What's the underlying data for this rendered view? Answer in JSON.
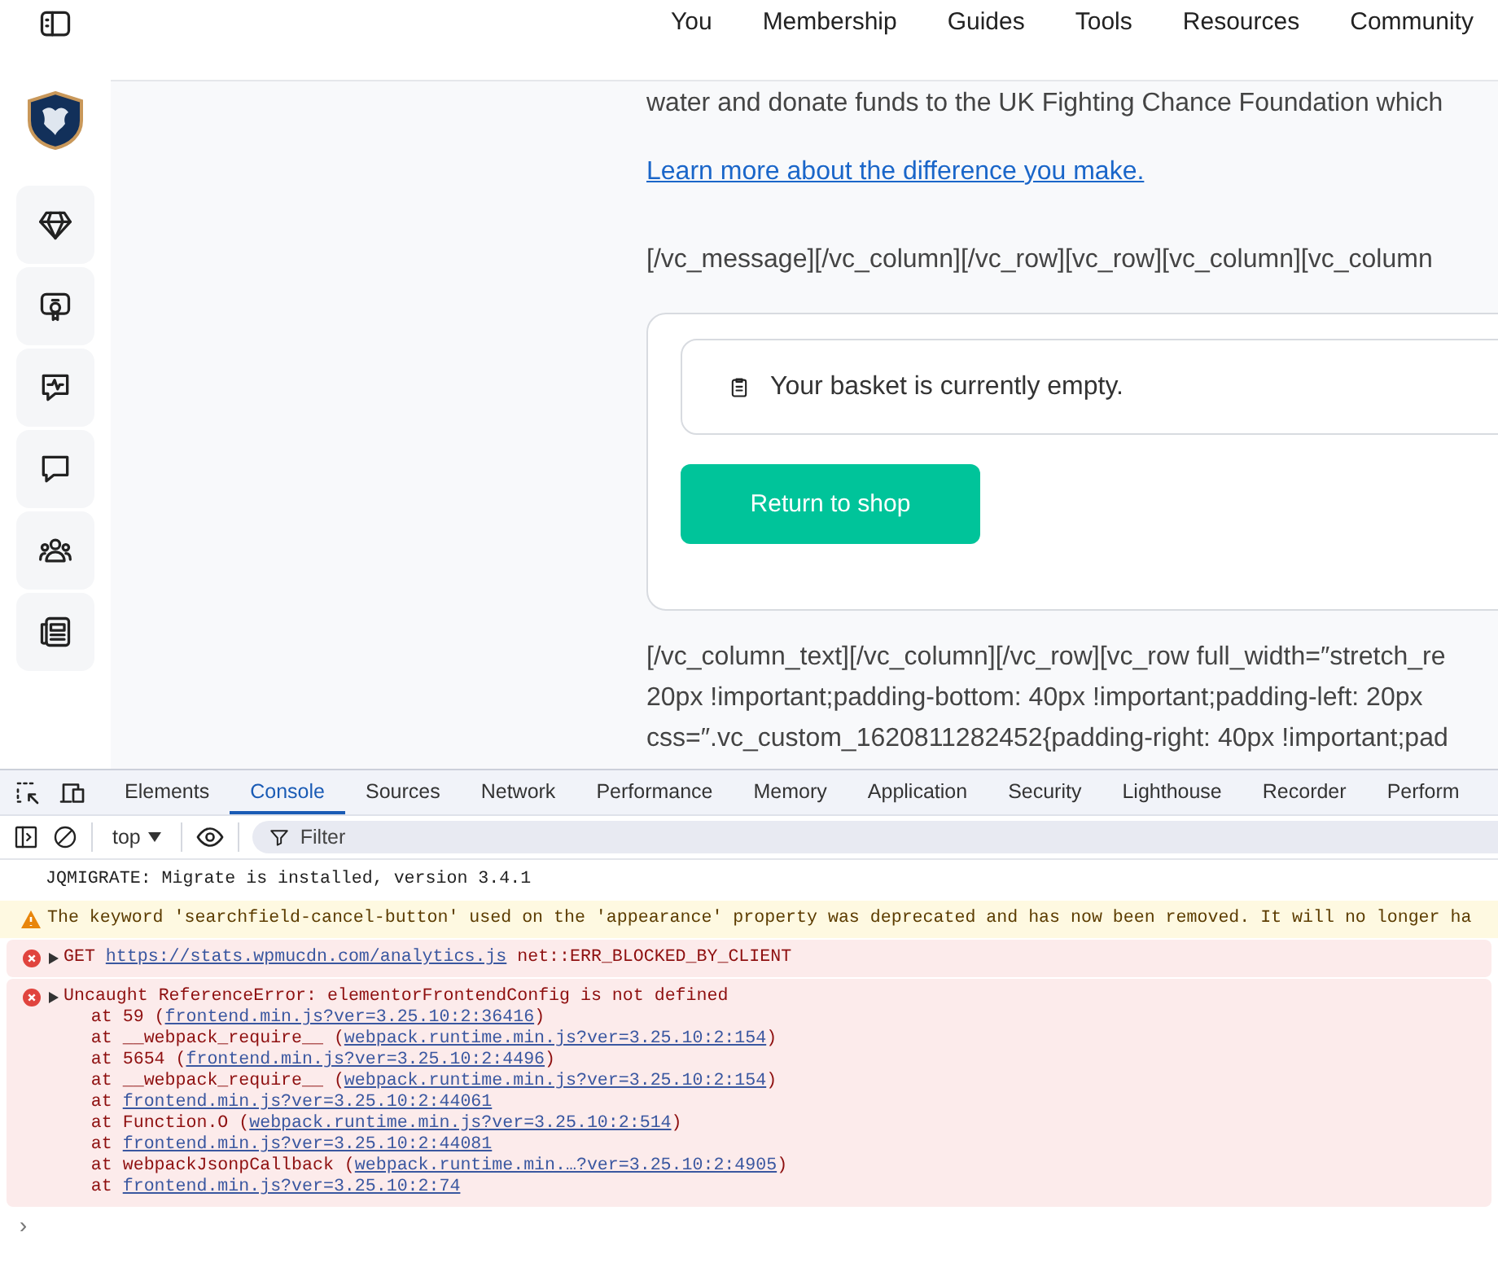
{
  "sidebar": {
    "items": [
      {
        "kind": "diamond"
      },
      {
        "kind": "badge"
      },
      {
        "kind": "pulse-chat"
      },
      {
        "kind": "chat"
      },
      {
        "kind": "people"
      },
      {
        "kind": "news"
      }
    ]
  },
  "nav": [
    "You",
    "Membership",
    "Guides",
    "Tools",
    "Resources",
    "Community"
  ],
  "content": {
    "cut_line": "water and donate funds to the UK Fighting Chance Foundation which",
    "link": "Learn more about the difference you make.",
    "shortcode": "[/vc_message][/vc_column][/vc_row][vc_row][vc_column][vc_column",
    "basket": {
      "message": "Your basket is currently empty.",
      "button": "Return to shop"
    },
    "trailing_lines": [
      "[/vc_column_text][/vc_column][/vc_row][vc_row full_width=″stretch_re",
      "20px !important;padding-bottom: 40px !important;padding-left: 20px",
      "css=″.vc_custom_1620811282452{padding-right: 40px !important;pad"
    ]
  },
  "devtools": {
    "tabs": [
      {
        "label": "Elements",
        "selected": false
      },
      {
        "label": "Console",
        "selected": true
      },
      {
        "label": "Sources",
        "selected": false
      },
      {
        "label": "Network",
        "selected": false
      },
      {
        "label": "Performance",
        "selected": false
      },
      {
        "label": "Memory",
        "selected": false
      },
      {
        "label": "Application",
        "selected": false
      },
      {
        "label": "Security",
        "selected": false
      },
      {
        "label": "Lighthouse",
        "selected": false
      },
      {
        "label": "Recorder",
        "selected": false
      },
      {
        "label": "Perform",
        "selected": false
      }
    ],
    "context": "top",
    "filter_placeholder": "Filter",
    "messages": [
      {
        "kind": "log",
        "lines": [
          [
            {
              "text": "JQMIGRATE: Migrate is installed, version 3.4.1"
            }
          ]
        ]
      },
      {
        "kind": "warning",
        "lines": [
          [
            {
              "text": "The keyword 'searchfield-cancel-button' used on the 'appearance' property was deprecated and has now been removed. It will no longer ha"
            }
          ]
        ]
      },
      {
        "kind": "error",
        "expanded": false,
        "lines": [
          [
            {
              "text": "GET "
            },
            {
              "link": "https://stats.wpmucdn.com/analytics.js"
            },
            {
              "text": " net::ERR_BLOCKED_BY_CLIENT"
            }
          ]
        ]
      },
      {
        "kind": "error",
        "expanded": false,
        "lines": [
          [
            {
              "text": "Uncaught ReferenceError: elementorFrontendConfig is not defined"
            }
          ],
          [
            {
              "text": "    at 59 ("
            },
            {
              "link": "frontend.min.js?ver=3.25.10:2:36416"
            },
            {
              "text": ")"
            }
          ],
          [
            {
              "text": "    at __webpack_require__ ("
            },
            {
              "link": "webpack.runtime.min.js?ver=3.25.10:2:154"
            },
            {
              "text": ")"
            }
          ],
          [
            {
              "text": "    at 5654 ("
            },
            {
              "link": "frontend.min.js?ver=3.25.10:2:4496"
            },
            {
              "text": ")"
            }
          ],
          [
            {
              "text": "    at __webpack_require__ ("
            },
            {
              "link": "webpack.runtime.min.js?ver=3.25.10:2:154"
            },
            {
              "text": ")"
            }
          ],
          [
            {
              "text": "    at "
            },
            {
              "link": "frontend.min.js?ver=3.25.10:2:44061"
            }
          ],
          [
            {
              "text": "    at Function.O ("
            },
            {
              "link": "webpack.runtime.min.js?ver=3.25.10:2:514"
            },
            {
              "text": ")"
            }
          ],
          [
            {
              "text": "    at "
            },
            {
              "link": "frontend.min.js?ver=3.25.10:2:44081"
            }
          ],
          [
            {
              "text": "    at webpackJsonpCallback ("
            },
            {
              "link": "webpack.runtime.min.…?ver=3.25.10:2:4905"
            },
            {
              "text": ")"
            }
          ],
          [
            {
              "text": "    at "
            },
            {
              "link": "frontend.min.js?ver=3.25.10:2:74"
            }
          ]
        ]
      }
    ],
    "prompt": "›"
  }
}
